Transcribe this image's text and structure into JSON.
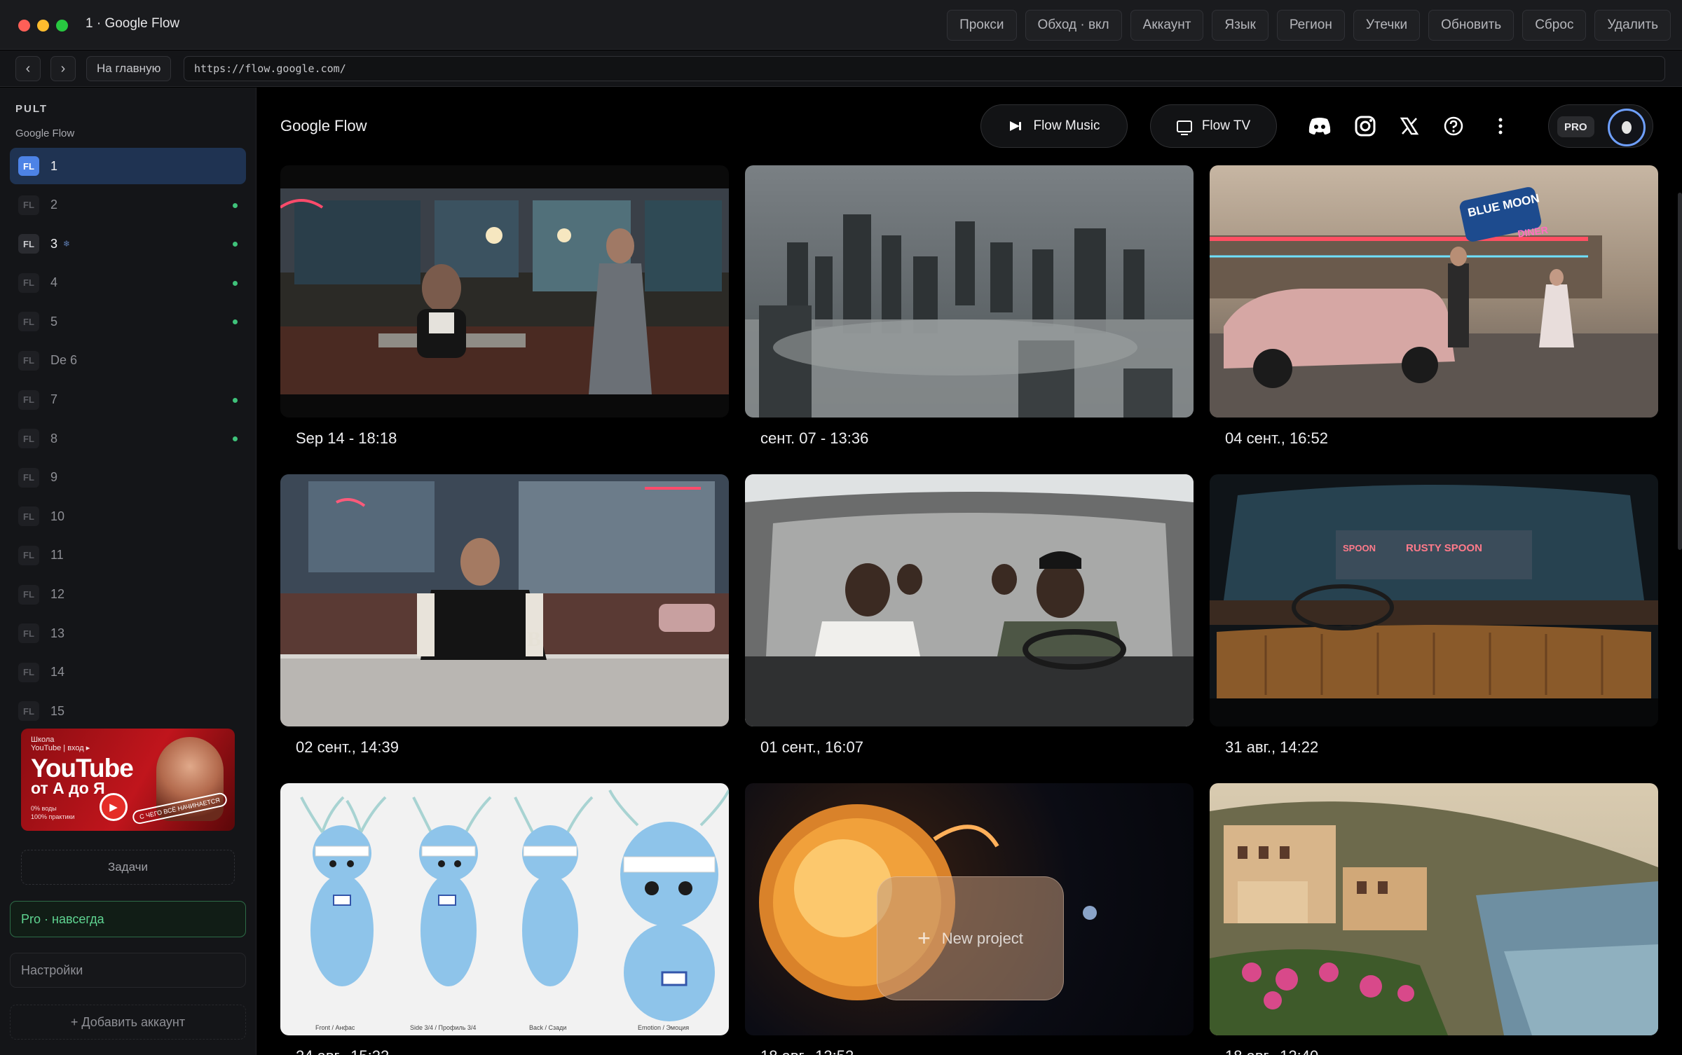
{
  "window": {
    "title": "1 · Google Flow"
  },
  "toolbar": {
    "buttons": [
      "Прокси",
      "Обход · вкл",
      "Аккаунт",
      "Язык",
      "Регион",
      "Утечки",
      "Обновить",
      "Сброс",
      "Удалить"
    ]
  },
  "addressbar": {
    "back": "‹",
    "forward": "›",
    "home_label": "На главную",
    "url": "https://flow.google.com/"
  },
  "sidebar": {
    "brand": "PULT",
    "group": "Google Flow",
    "badge": "FL",
    "accounts": [
      {
        "label": "1",
        "active": true,
        "dot": false
      },
      {
        "label": "2",
        "active": false,
        "dot": true
      },
      {
        "label": "3",
        "active": false,
        "dot": true,
        "bright": true,
        "snow": true
      },
      {
        "label": "4",
        "active": false,
        "dot": true
      },
      {
        "label": "5",
        "active": false,
        "dot": true
      },
      {
        "label": "De 6",
        "active": false,
        "dot": false
      },
      {
        "label": "7",
        "active": false,
        "dot": true
      },
      {
        "label": "8",
        "active": false,
        "dot": true
      },
      {
        "label": "9",
        "active": false,
        "dot": false
      },
      {
        "label": "10",
        "active": false,
        "dot": false
      },
      {
        "label": "11",
        "active": false,
        "dot": false
      },
      {
        "label": "12",
        "active": false,
        "dot": false
      },
      {
        "label": "13",
        "active": false,
        "dot": false
      },
      {
        "label": "14",
        "active": false,
        "dot": false
      },
      {
        "label": "15",
        "active": false,
        "dot": false
      }
    ],
    "promo": {
      "small_line1": "Школа",
      "small_line2": "YouTube | вход ▸",
      "title": "YouTube",
      "subtitle": "от А до Я",
      "bullet1": "0% воды",
      "bullet2": "100% практики",
      "bubble": "С ЧЕГО ВСЁ НАЧИНАЕТСЯ"
    },
    "tasks_label": "Задачи",
    "pro_label": "Pro · навсегда",
    "settings_label": "Настройки",
    "add_account_label": "+ Добавить аккаунт"
  },
  "main": {
    "title": "Google Flow",
    "flow_music_label": "Flow Music",
    "flow_tv_label": "Flow TV",
    "pro_tag": "PRO",
    "new_project_label": "New project",
    "projects": [
      {
        "caption": "Sep 14 - 18:18",
        "scene": "diner-night"
      },
      {
        "caption": "сент. 07 - 13:36",
        "scene": "ruined-city-fog"
      },
      {
        "caption": "04 сент., 16:52",
        "scene": "retro-diner-car"
      },
      {
        "caption": "02 сент., 14:39",
        "scene": "diner-booth"
      },
      {
        "caption": "01 сент., 16:07",
        "scene": "car-interior"
      },
      {
        "caption": "31 авг., 14:22",
        "scene": "car-dashboard-rain"
      },
      {
        "caption": "24 авг., 15:22",
        "scene": "character-sheet"
      },
      {
        "caption": "18 авг., 12:52",
        "scene": "sun-space"
      },
      {
        "caption": "18 авг., 12:40",
        "scene": "coastal-town"
      }
    ],
    "character_sheet_labels": [
      "Front / Анфас",
      "Side 3/4 / Профиль 3/4",
      "Back / Сзади",
      "Emotion / Эмоция"
    ],
    "sign_texts": {
      "blue_moon": "BLUE MOON",
      "diner": "DINER",
      "spoon": "SPOON",
      "rusty_spoon": "RUSTY SPOON"
    }
  },
  "colors": {
    "accent": "#4d83e6",
    "status_dot": "#3fc27a",
    "pro_green": "#5fd491",
    "avatar_ring": "#6fa0ff"
  }
}
